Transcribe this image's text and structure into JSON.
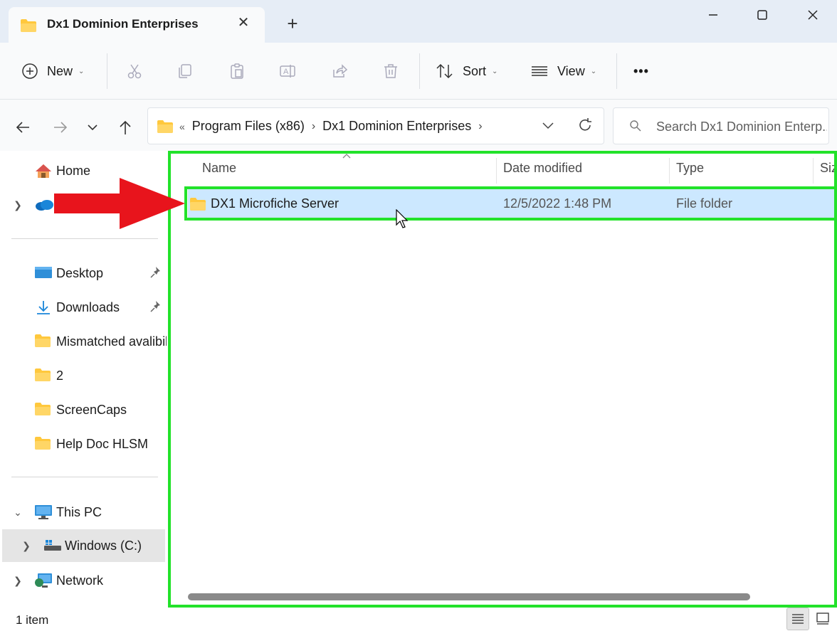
{
  "window": {
    "tab_title": "Dx1 Dominion Enterprises",
    "tab_close": "✕",
    "tab_add": "+"
  },
  "command_bar": {
    "new_label": "New",
    "sort_label": "Sort",
    "view_label": "View",
    "more_label": "•••"
  },
  "address": {
    "overflow": "«",
    "crumbs": [
      "Program Files (x86)",
      "Dx1 Dominion Enterprises"
    ],
    "search_placeholder": "Search Dx1 Dominion Enterp..."
  },
  "sidebar": {
    "home": "Home",
    "quick_access": [
      {
        "label": "Desktop",
        "pinned": true
      },
      {
        "label": "Downloads",
        "pinned": true
      },
      {
        "label": "Mismatched avalibil",
        "pinned": false
      },
      {
        "label": "2",
        "pinned": false
      },
      {
        "label": "ScreenCaps",
        "pinned": false
      },
      {
        "label": "Help Doc HLSM",
        "pinned": false
      }
    ],
    "this_pc": "This PC",
    "windows_drive": "Windows  (C:)",
    "network": "Network"
  },
  "file_list": {
    "columns": [
      "Name",
      "Date modified",
      "Type",
      "Siz"
    ],
    "rows": [
      {
        "name": "DX1 Microfiche Server",
        "date_modified": "12/5/2022 1:48 PM",
        "type": "File folder"
      }
    ]
  },
  "status": {
    "item_count": "1 item"
  },
  "colors": {
    "highlight_green": "#22e22a",
    "arrow_red": "#e8141c",
    "selection_blue": "#cce8ff",
    "folder_yellow": "#ffc83d"
  }
}
